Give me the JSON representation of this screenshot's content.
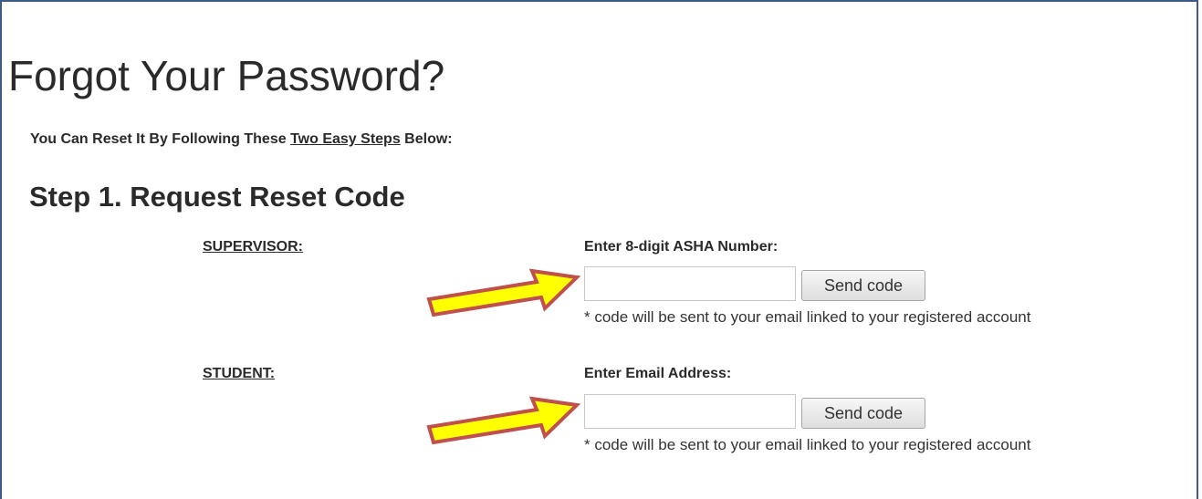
{
  "page": {
    "title": "Forgot Your Password?",
    "intro_before": "You Can Reset It By Following These ",
    "intro_emphasis": "Two Easy Steps",
    "intro_after": " Below:"
  },
  "step1": {
    "title": "Step 1. Request Reset Code",
    "supervisor": {
      "role_label": "SUPERVISOR:",
      "field_label": "Enter 8-digit ASHA Number:",
      "input_value": "",
      "button_label": "Send code",
      "note": "* code will be sent to your email linked to your registered account"
    },
    "student": {
      "role_label": "STUDENT:",
      "field_label": "Enter Email Address:",
      "input_value": "",
      "button_label": "Send code",
      "note": "* code will be sent to your email linked to your registered account"
    }
  },
  "annotation": {
    "arrow_fill": "#ffff00",
    "arrow_stroke": "#c0504d",
    "frame_color": "#3b5b8a"
  }
}
